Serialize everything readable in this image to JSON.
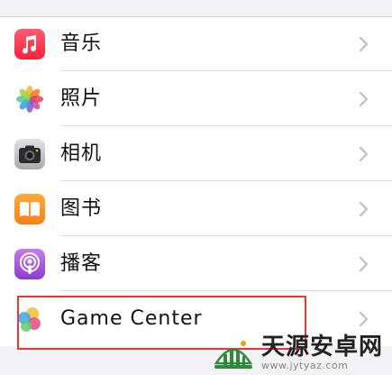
{
  "settings_list": {
    "items": [
      {
        "label": "音乐",
        "icon": "music-icon"
      },
      {
        "label": "照片",
        "icon": "photos-icon"
      },
      {
        "label": "相机",
        "icon": "camera-icon"
      },
      {
        "label": "图书",
        "icon": "books-icon"
      },
      {
        "label": "播客",
        "icon": "podcasts-icon"
      },
      {
        "label": "Game Center",
        "icon": "game-center-icon"
      }
    ]
  },
  "highlight": {
    "color": "#e53935"
  },
  "watermark": {
    "name": "天源安卓网",
    "url": "www.jytyaz.com"
  },
  "colors": {
    "background": "#f2f2f7",
    "chevron": "#c4c4c9"
  }
}
